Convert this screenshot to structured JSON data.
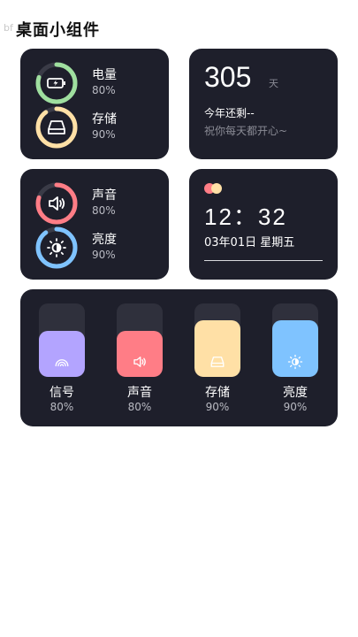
{
  "ghost_text": "bf",
  "page_title": "桌面小组件",
  "colors": {
    "card_bg": "#1e1f2b",
    "track": "#2f303c",
    "green": "#9fdf9f",
    "yellow": "#ffe0a6",
    "red": "#ff7d86",
    "blue": "#7fc3ff",
    "purple": "#b3a4ff"
  },
  "status_widget": {
    "items": [
      {
        "label": "电量",
        "value": "80%",
        "percent": 80,
        "color": "#9fdf9f",
        "icon": "battery-charging-icon"
      },
      {
        "label": "存储",
        "value": "90%",
        "percent": 90,
        "color": "#ffe0a6",
        "icon": "storage-drive-icon"
      }
    ]
  },
  "countdown_widget": {
    "days": "305",
    "unit": "天",
    "line1": "今年还剩--",
    "line2": "祝你每天都开心~"
  },
  "media_widget": {
    "items": [
      {
        "label": "声音",
        "value": "80%",
        "percent": 80,
        "color": "#ff7d86",
        "icon": "volume-icon"
      },
      {
        "label": "亮度",
        "value": "90%",
        "percent": 90,
        "color": "#7fc3ff",
        "icon": "brightness-icon"
      }
    ]
  },
  "clock_widget": {
    "time": "12：32",
    "date": "03年01日   星期五",
    "dot_colors": [
      "#ff7d86",
      "#ffe0a6"
    ]
  },
  "slider_widget": {
    "items": [
      {
        "label": "信号",
        "value": "80%",
        "percent": 80,
        "color": "#b3a4ff",
        "icon": "signal-icon"
      },
      {
        "label": "声音",
        "value": "80%",
        "percent": 80,
        "color": "#ff7d86",
        "icon": "volume-icon"
      },
      {
        "label": "存储",
        "value": "90%",
        "percent": 90,
        "color": "#ffe0a6",
        "icon": "storage-drive-icon"
      },
      {
        "label": "亮度",
        "value": "90%",
        "percent": 90,
        "color": "#7fc3ff",
        "icon": "brightness-icon"
      }
    ]
  }
}
